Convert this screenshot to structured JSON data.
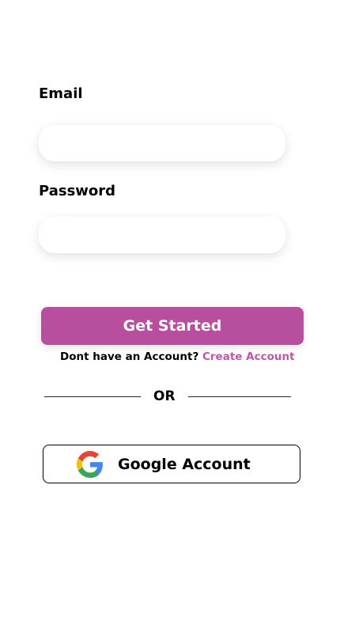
{
  "form": {
    "email_label": "Email",
    "email_value": "",
    "password_label": "Password",
    "password_value": "",
    "submit_label": "Get Started",
    "signup_prompt": "Dont have an Account?",
    "signup_link": "Create Account",
    "divider_text": "OR",
    "google_label": "Google Account"
  },
  "colors": {
    "accent": "#b74f9e",
    "link": "#c255a8"
  }
}
